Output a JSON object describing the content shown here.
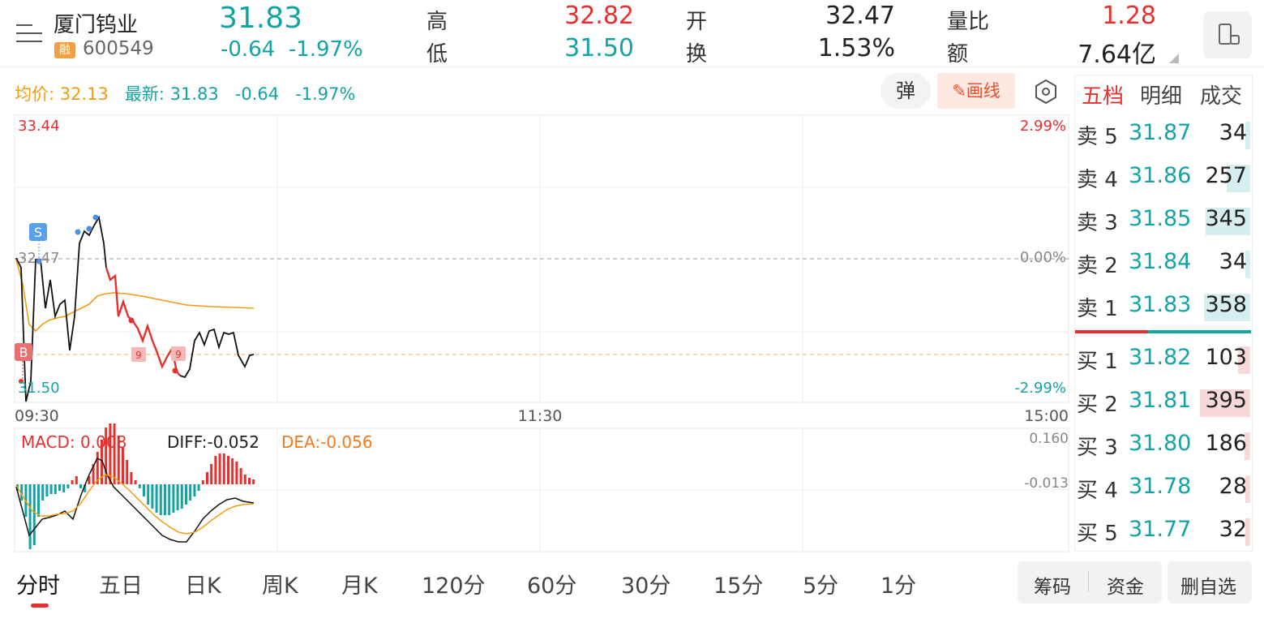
{
  "header": {
    "name": "厦门钨业",
    "rong": "融",
    "code": "600549",
    "price": "31.83",
    "change": "-0.64",
    "change_pct": "-1.97%",
    "stats": [
      {
        "label": "高",
        "value": "32.82",
        "color": "#e5302f"
      },
      {
        "label": "低",
        "value": "31.50",
        "color": "#13a3a3"
      },
      {
        "label": "开",
        "value": "32.47",
        "color": "#222222"
      },
      {
        "label": "换",
        "value": "1.53%",
        "color": "#222222"
      },
      {
        "label": "量比",
        "value": "1.28",
        "color": "#e5302f"
      },
      {
        "label": "额",
        "value": "7.64亿",
        "color": "#222222"
      }
    ]
  },
  "info": {
    "avg_label": "均价: 32.13",
    "latest_label": "最新: 31.83",
    "latest_change": "-0.64",
    "latest_pct": "-1.97%",
    "dan": "弹",
    "draw": "画线"
  },
  "chart": {
    "price_high": "33.44",
    "price_low": "31.50",
    "pct_high": "2.99%",
    "pct_mid": "0.00%",
    "pct_low": "-2.99%",
    "mid_price": "32.47",
    "times": [
      "09:30",
      "11:30",
      "15:00"
    ],
    "marker_s": "S",
    "marker_b": "B",
    "marker_9a": "9",
    "marker_9b": "9",
    "macd_label": "MACD: 0.008",
    "diff_label": "DIFF:-0.052",
    "dea_label": "DEA:-0.056",
    "macd_top": "0.160",
    "macd_mid": "-0.013"
  },
  "orderbook": {
    "tabs": [
      "五档",
      "明细",
      "成交"
    ],
    "sells": [
      {
        "label": "卖 5",
        "price": "31.87",
        "vol": "34",
        "bar": 0.02
      },
      {
        "label": "卖 4",
        "price": "31.86",
        "vol": "257",
        "bar": 0.13
      },
      {
        "label": "卖 3",
        "price": "31.85",
        "vol": "345",
        "bar": 0.25
      },
      {
        "label": "卖 2",
        "price": "31.84",
        "vol": "34",
        "bar": 0.02
      },
      {
        "label": "卖 1",
        "price": "31.83",
        "vol": "358",
        "bar": 0.26
      }
    ],
    "buys": [
      {
        "label": "买 1",
        "price": "31.82",
        "vol": "103",
        "bar": 0.07
      },
      {
        "label": "买 2",
        "price": "31.81",
        "vol": "395",
        "bar": 0.28
      },
      {
        "label": "买 3",
        "price": "31.80",
        "vol": "186",
        "bar": 0.03
      },
      {
        "label": "买 4",
        "price": "31.78",
        "vol": "28",
        "bar": 0.01
      },
      {
        "label": "买 5",
        "price": "31.77",
        "vol": "32",
        "bar": 0.02
      }
    ]
  },
  "bottom": {
    "tabs": [
      "分时",
      "五日",
      "日K",
      "周K",
      "月K",
      "120分",
      "60分",
      "30分",
      "15分",
      "5分",
      "1分"
    ],
    "chips": "筹码",
    "funds": "资金",
    "remove": "删自选"
  },
  "colors": {
    "up": "#e5302f",
    "down": "#13a3a3",
    "avg": "#f39c12"
  }
}
